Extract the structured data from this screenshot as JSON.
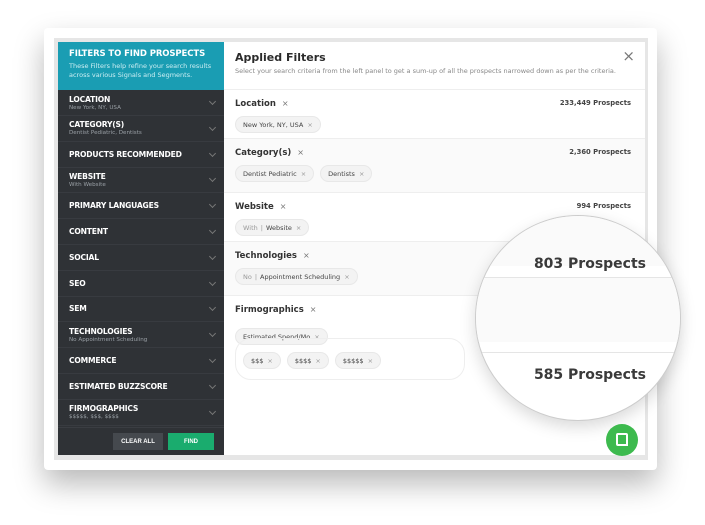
{
  "sidebar": {
    "title": "FILTERS TO FIND PROSPECTS",
    "description": "These Filters help refine your search results across various Signals and Segments.",
    "items": [
      {
        "label": "LOCATION",
        "sub": "New York, NY, USA"
      },
      {
        "label": "CATEGORY(S)",
        "sub": "Dentist Pediatric, Dentists"
      },
      {
        "label": "PRODUCTS RECOMMENDED",
        "sub": ""
      },
      {
        "label": "WEBSITE",
        "sub": "With Website"
      },
      {
        "label": "PRIMARY LANGUAGES",
        "sub": ""
      },
      {
        "label": "CONTENT",
        "sub": ""
      },
      {
        "label": "SOCIAL",
        "sub": ""
      },
      {
        "label": "SEO",
        "sub": ""
      },
      {
        "label": "SEM",
        "sub": ""
      },
      {
        "label": "TECHNOLOGIES",
        "sub": "No Appointment Scheduling"
      },
      {
        "label": "COMMERCE",
        "sub": ""
      },
      {
        "label": "ESTIMATED BUZZSCORE",
        "sub": ""
      },
      {
        "label": "FIRMOGRAPHICS",
        "sub": "$$$$$, $$$, $$$$"
      }
    ],
    "clear_label": "CLEAR ALL",
    "find_label": "FIND"
  },
  "main": {
    "title": "Applied Filters",
    "subtitle": "Select your search criteria from the left panel to get a sum-up of all the prospects narrowed down as per the criteria.",
    "close": "×",
    "sections": [
      {
        "title": "Location",
        "count": "233,449 Prospects",
        "chips": [
          {
            "pre": "",
            "label": "New York, NY, USA"
          }
        ]
      },
      {
        "title": "Category(s)",
        "count": "2,360 Prospects",
        "chips": [
          {
            "pre": "",
            "label": "Dentist Pediatric"
          },
          {
            "pre": "",
            "label": "Dentists"
          }
        ]
      },
      {
        "title": "Website",
        "count": "994 Prospects",
        "chips": [
          {
            "pre": "With",
            "label": "Website"
          }
        ]
      },
      {
        "title": "Technologies",
        "count": "",
        "chips": [
          {
            "pre": "No",
            "label": "Appointment Scheduling"
          }
        ]
      },
      {
        "title": "Firmographics",
        "count": "",
        "chips": [
          {
            "pre": "",
            "label": "Estimated Spend/Mo"
          }
        ],
        "subchips": [
          "$$$",
          "$$$$",
          "$$$$$"
        ]
      }
    ]
  },
  "magnifier": {
    "count1": "803 Prospects",
    "count2": "585 Prospects"
  },
  "colors": {
    "sidebar_header": "#1a9db3",
    "sidebar": "#2f3236",
    "find": "#1aac6e",
    "chat": "#3dba4e"
  },
  "chat": {
    "icon": "chat-icon"
  }
}
